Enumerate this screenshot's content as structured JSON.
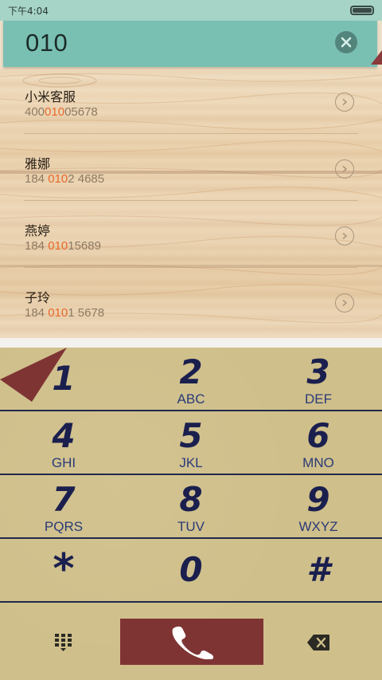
{
  "status_bar": {
    "time": "下午4:04",
    "battery_level": 1.0
  },
  "dialer": {
    "number": "010",
    "clear_icon": "clear-circle-x-icon"
  },
  "contacts": [
    {
      "name": "小米客服",
      "number_before": "400",
      "number_match": "010",
      "number_after": "05678"
    },
    {
      "name": "雅娜",
      "number_before": "184 ",
      "number_match": "010",
      "number_after": "2 4685"
    },
    {
      "name": "燕婷",
      "number_before": "184 ",
      "number_match": "010",
      "number_after": "15689"
    },
    {
      "name": "子玲",
      "number_before": "184 ",
      "number_match": "010",
      "number_after": "1 5678"
    }
  ],
  "keypad": {
    "keys": [
      {
        "digit": "1",
        "letters": ""
      },
      {
        "digit": "2",
        "letters": "ABC"
      },
      {
        "digit": "3",
        "letters": "DEF"
      },
      {
        "digit": "4",
        "letters": "GHI"
      },
      {
        "digit": "5",
        "letters": "JKL"
      },
      {
        "digit": "6",
        "letters": "MNO"
      },
      {
        "digit": "7",
        "letters": "PQRS"
      },
      {
        "digit": "8",
        "letters": "TUV"
      },
      {
        "digit": "9",
        "letters": "WXYZ"
      },
      {
        "digit": "*",
        "letters": ""
      },
      {
        "digit": "0",
        "letters": ""
      },
      {
        "digit": "#",
        "letters": ""
      }
    ]
  },
  "actions": {
    "left_icon": "dialpad-grid-icon",
    "call_icon": "phone-handset-icon",
    "right_icon": "backspace-icon"
  },
  "colors": {
    "display_bg": "#79c0b3",
    "keypad_bg": "#cfbf8a",
    "digit_color": "#1a1f4e",
    "highlight": "#e8682a",
    "call_button": "#7f3434"
  }
}
